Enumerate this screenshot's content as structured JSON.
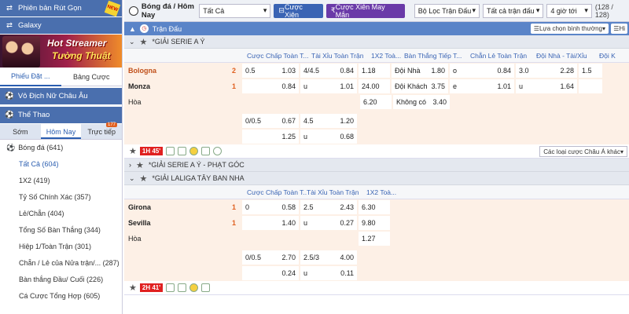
{
  "sidebar": {
    "withdraw_version": "Phiên bản Rút Gọn",
    "new_badge": "NEW",
    "galaxy": "Galaxy",
    "banner_line1": "Hot Streamer",
    "banner_line2": "Tường Thuật",
    "tabs": [
      "Phiếu Đặt ...",
      "Bảng Cược"
    ],
    "promo_section": "Vô Địch Nữ Châu Âu",
    "sports_section": "Thể Thao",
    "sub_tabs": [
      "Sớm",
      "Hôm Nay",
      "Trực tiếp"
    ],
    "live_count": "177",
    "sport": "Bóng đá (641)",
    "list": [
      "Tất Cả (604)",
      "1X2 (419)",
      "Tỷ Số Chính Xác (357)",
      "Lẻ/Chẵn (404)",
      "Tổng Số Bàn Thắng (344)",
      "Hiệp 1/Toàn Trận (301)",
      "Chẵn / Lẻ của Nửa trận/... (287)",
      "Bàn thắng Đầu/ Cuối (226)",
      "Cá Cược Tổng Hợp (605)"
    ]
  },
  "topbar": {
    "crumb": "Bóng đá / Hôm Nay",
    "filter_all": "Tất Cả",
    "btn_parlay": "Cược Xiên",
    "btn_lucky": "Cược Xiên May Mắn",
    "match_filter": "Bộ Lọc Trận Đấu",
    "all_matches": "Tất cả trận đấu",
    "hours": "4 giờ tới",
    "count": "(128 / 128)"
  },
  "main": {
    "section": "Trận Đấu",
    "sort": "Lựa chọn bình thường",
    "hi": "Hi",
    "leagues": [
      "*GIẢI SERIE A Ý",
      "*GIẢI SERIE A Ý - PHẠT GÓC",
      "*GIẢI LALIGA TÂY BAN NHA"
    ],
    "columns": [
      "Cược Chấp Toàn T...",
      "Tài Xỉu Toàn Trận",
      "1X2 Toà...",
      "Bàn Thắng Tiếp T...",
      "Chẵn Lẻ Toàn Trận",
      "Đội Nhà - Tài/Xỉu",
      "Đội K"
    ],
    "columns2": [
      "Cược Chấp Toàn T...",
      "Tài Xỉu Toàn Trận",
      "1X2 Toà..."
    ],
    "m1": {
      "home": "Bologna",
      "away": "Monza",
      "draw": "Hòa",
      "home_score": "2",
      "away_score": "1",
      "time": "1H 45'"
    },
    "m2": {
      "home": "Girona",
      "away": "Sevilla",
      "draw": "Hòa",
      "home_score": "1",
      "away_score": "1",
      "time": "2H 41'"
    },
    "other_odds": "Các loại cược Châu Á khác",
    "m1_hdp": [
      [
        "0.5",
        "1.03"
      ],
      [
        "",
        "0.84"
      ]
    ],
    "m1_ou": [
      [
        "4/4.5",
        "0.84"
      ],
      [
        "u",
        "1.01"
      ]
    ],
    "m1_1x2": [
      "1.18",
      "24.00",
      "6.20"
    ],
    "m1_next": [
      [
        "Đội Nhà",
        "1.80"
      ],
      [
        "Đội Khách",
        "3.75"
      ],
      [
        "Không có",
        "3.40"
      ]
    ],
    "m1_oe": [
      [
        "o",
        "0.84"
      ],
      [
        "e",
        "1.01"
      ]
    ],
    "m1_hou": [
      [
        "3.0",
        "2.28"
      ],
      [
        "u",
        "1.64"
      ]
    ],
    "m1_aou": [
      "1.5",
      ""
    ],
    "m1_hdp2": [
      [
        "0/0.5",
        "0.67"
      ],
      [
        "",
        "1.25"
      ]
    ],
    "m1_ou2": [
      [
        "4.5",
        "1.20"
      ],
      [
        "u",
        "0.68"
      ]
    ],
    "m2_hdp": [
      [
        "0",
        "0.58"
      ],
      [
        "",
        "1.40"
      ]
    ],
    "m2_ou": [
      [
        "2.5",
        "2.43"
      ],
      [
        "u",
        "0.27"
      ]
    ],
    "m2_1x2": [
      "6.30",
      "9.80",
      "1.27"
    ],
    "m2_hdp2": [
      [
        "0/0.5",
        "2.70"
      ],
      [
        "",
        "0.24"
      ]
    ],
    "m2_ou2": [
      [
        "2.5/3",
        "4.00"
      ],
      [
        "u",
        "0.11"
      ]
    ]
  }
}
